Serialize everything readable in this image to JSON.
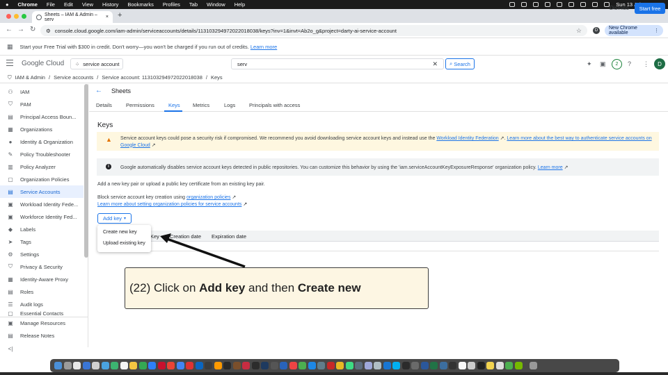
{
  "menubar": {
    "app": "Chrome",
    "items": [
      "File",
      "Edit",
      "View",
      "History",
      "Bookmarks",
      "Profiles",
      "Tab",
      "Window",
      "Help"
    ],
    "datetime": "Sun 13 Jul  17:07:33"
  },
  "browser": {
    "tab_title": "Sheets – IAM & Admin – serv",
    "tab_close": "×",
    "new_tab": "+",
    "url": "console.cloud.google.com/iam-admin/serviceaccounts/details/113103294972022018038/keys?inv=1&invt=Ab2o_g&project=darty-ai-service-account",
    "profile_initial": "D",
    "new_chrome_label": "New Chrome available",
    "new_chrome_menu": "⋮"
  },
  "trial_banner": {
    "text": "Start your Free Trial with $300 in credit. Don't worry—you won't be charged if you run out of credits.",
    "link": "Learn more",
    "dismiss": "Dismiss",
    "start": "Start free"
  },
  "header": {
    "logo": "Google Cloud",
    "project": "service account",
    "search_value": "serv",
    "search_clear": "✕",
    "search_button": "Search",
    "notifications": "2",
    "avatar": "D"
  },
  "breadcrumb": [
    "IAM & Admin",
    "Service accounts",
    "Service account: 113103294972022018038",
    "Keys"
  ],
  "sidebar": {
    "items": [
      {
        "label": "IAM",
        "icon": "person-add-icon"
      },
      {
        "label": "PAM",
        "icon": "shield-icon"
      },
      {
        "label": "Principal Access Boun...",
        "icon": "policy-icon"
      },
      {
        "label": "Organizations",
        "icon": "org-icon"
      },
      {
        "label": "Identity & Organization",
        "icon": "identity-icon"
      },
      {
        "label": "Policy Troubleshooter",
        "icon": "wrench-icon"
      },
      {
        "label": "Policy Analyzer",
        "icon": "analyzer-icon"
      },
      {
        "label": "Organization Policies",
        "icon": "doc-icon"
      },
      {
        "label": "Service Accounts",
        "icon": "service-account-icon"
      },
      {
        "label": "Workload Identity Fede...",
        "icon": "workload-icon"
      },
      {
        "label": "Workforce Identity Fed...",
        "icon": "workforce-icon"
      },
      {
        "label": "Labels",
        "icon": "label-icon"
      },
      {
        "label": "Tags",
        "icon": "tag-icon"
      },
      {
        "label": "Settings",
        "icon": "gear-icon"
      },
      {
        "label": "Privacy & Security",
        "icon": "lock-icon"
      },
      {
        "label": "Identity-Aware Proxy",
        "icon": "proxy-icon"
      },
      {
        "label": "Roles",
        "icon": "roles-icon"
      },
      {
        "label": "Audit logs",
        "icon": "list-icon"
      },
      {
        "label": "Essential Contacts",
        "icon": "contacts-icon"
      }
    ],
    "footer": [
      {
        "label": "Manage Resources",
        "icon": "resources-icon"
      },
      {
        "label": "Release Notes",
        "icon": "notes-icon"
      }
    ],
    "collapse": "<|"
  },
  "main": {
    "title": "Sheets",
    "tabs": [
      "Details",
      "Permissions",
      "Keys",
      "Metrics",
      "Logs",
      "Principals with access"
    ],
    "active_tab": "Keys",
    "section_title": "Keys",
    "warning": {
      "text1": "Service account keys could pose a security risk if compromised. We recommend you avoid downloading service account keys and instead use the",
      "link1": "Workload Identity Federation",
      "text2": ". ",
      "link2a": "Learn more about the best way to authenticate service accounts on",
      "link2b": "Google Cloud"
    },
    "info": {
      "text": "Google automatically disables service account keys detected in public repositories. You can customize this behavior by using the 'iam.serviceAccountKeyExposureResponse' organization policy.",
      "link": "Learn more"
    },
    "add_text": "Add a new key pair or upload a public key certificate from an existing key pair.",
    "block_text": "Block service account key creation using",
    "block_link": "organization policies",
    "learn_org": "Learn more about setting organization policies for service accounts",
    "add_key": "Add key",
    "menu": [
      "Create new key",
      "Upload existing key"
    ],
    "table_headers": [
      "Key",
      "Creation date",
      "Expiration date"
    ]
  },
  "callout": {
    "prefix": "(22) Click on ",
    "bold1": "Add key",
    "mid": " and then ",
    "bold2": "Create new"
  },
  "colors": {
    "accent": "#1a73e8",
    "warning_bg": "#fef7e0",
    "callout_bg": "#fdf6e3"
  }
}
